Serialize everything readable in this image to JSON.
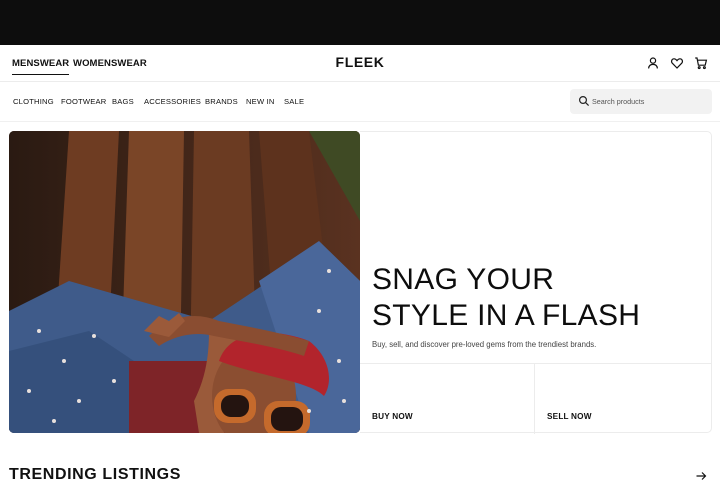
{
  "header": {
    "tabs": [
      {
        "label": "MENSWEAR",
        "active": true
      },
      {
        "label": "WOMENSWEAR",
        "active": false
      }
    ],
    "logo": "FLEEK",
    "icons": [
      "user-icon",
      "heart-icon",
      "cart-icon"
    ]
  },
  "nav": {
    "items": [
      "CLOTHING",
      "FOOTWEAR",
      "BAGS",
      "ACCESSORIES",
      "BRANDS",
      "NEW IN",
      "SALE"
    ],
    "search": {
      "placeholder": "Search products",
      "icon": "search-icon"
    }
  },
  "hero": {
    "headline_line1": "SNAG YOUR",
    "headline_line2": "STYLE IN A FLASH",
    "subtext": "Buy, sell, and discover pre-loved gems from the trendiest brands.",
    "buy_label": "BUY NOW",
    "sell_label": "SELL NOW"
  },
  "trending": {
    "title": "TRENDING LISTINGS",
    "arrow_icon": "arrow-right-icon"
  },
  "colors": {
    "top_bar": "#0d0d0d",
    "text": "#111111",
    "search_bg": "#f2f2f2",
    "border": "#ececec"
  }
}
